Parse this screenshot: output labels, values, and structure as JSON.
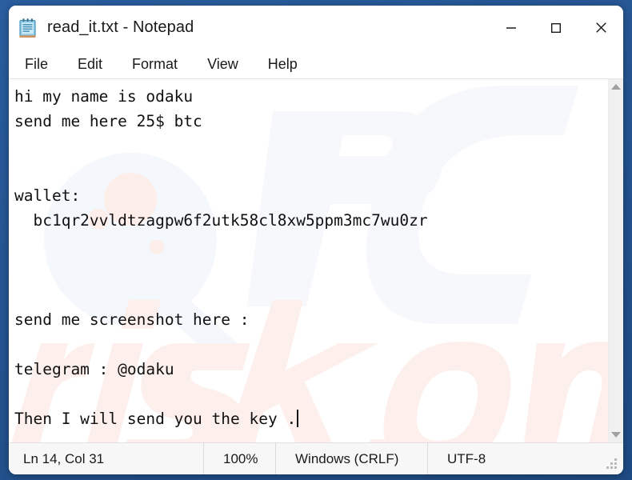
{
  "window": {
    "title": "read_it.txt - Notepad",
    "icon": "notepad-icon",
    "controls": {
      "minimize": "—",
      "maximize": "□",
      "close": "✕"
    }
  },
  "menu": {
    "items": [
      {
        "label": "File"
      },
      {
        "label": "Edit"
      },
      {
        "label": "Format"
      },
      {
        "label": "View"
      },
      {
        "label": "Help"
      }
    ]
  },
  "editor": {
    "lines": [
      "hi my name is odaku",
      "send me here 25$ btc",
      "",
      "",
      "wallet:",
      "  bc1qr2vvldtzagpw6f2utk58cl8xw5ppm3mc7wu0zr",
      "",
      "",
      "",
      "send me screenshot here :",
      "",
      "telegram : @odaku",
      "",
      "Then I will send you the key ."
    ],
    "wallet_address": "bc1qr2vvldtzagpw6f2utk58cl8xw5ppm3mc7wu0zr",
    "telegram_handle": "@odaku",
    "amount": "25$ btc",
    "caret_visible": true
  },
  "watermark": {
    "text": "PCrisk.com",
    "color": "#fdf0ec"
  },
  "scrollbar": {
    "up_arrow": "scroll-up-arrow",
    "down_arrow": "scroll-down-arrow"
  },
  "statusbar": {
    "position": "Ln 14, Col 31",
    "zoom": "100%",
    "line_ending": "Windows (CRLF)",
    "encoding": "UTF-8"
  },
  "colors": {
    "desktop": "#255a9e",
    "window": "#ffffff",
    "status_bar": "#f7f7f7",
    "text": "#111111"
  }
}
